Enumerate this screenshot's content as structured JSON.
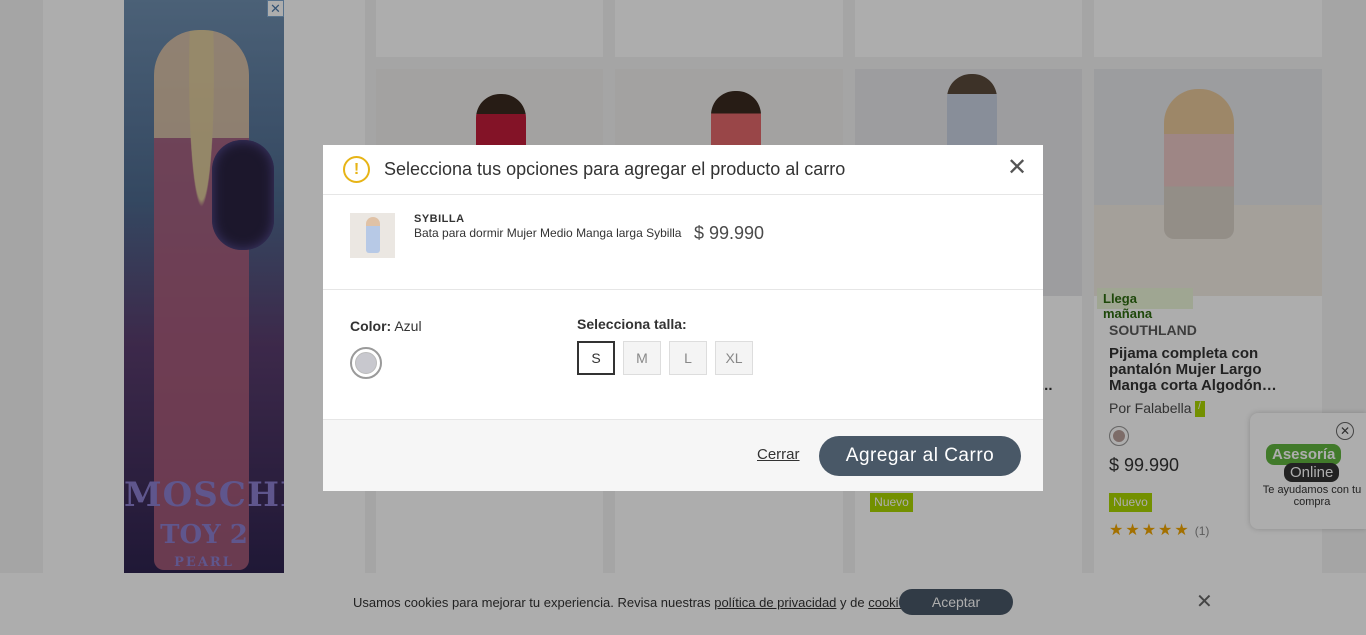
{
  "ad": {
    "brand_line1": "MOSCHINO",
    "brand_line2": "TOY 2",
    "brand_line3": "PEARL",
    "close": "✕"
  },
  "background_product": {
    "badge": "Llega mañana",
    "brand": "SOUTHLAND",
    "title": "Pijama completa con pantalón Mujer Largo Manga corta Algodón…",
    "seller": "Por Falabella",
    "seller_flag": "/",
    "price": "$ 99.990",
    "new_label": "Nuevo",
    "stars": "★★★★★",
    "rating_count": "(1)"
  },
  "background_other": {
    "new_label": "Nuevo",
    "partial_title": "..."
  },
  "chat": {
    "close": "✕",
    "line1": "Asesoría",
    "line2": "Online",
    "text": "Te ayudamos con tu compra"
  },
  "cookie": {
    "text_before": "Usamos cookies para mejorar tu experiencia. Revisa nuestras ",
    "privacy_link": "política de privacidad",
    "text_mid": " y de ",
    "cookies_link": "cookies",
    "text_end": ".",
    "accept": "Aceptar",
    "close": "✕"
  },
  "modal": {
    "warning_icon": "!",
    "title": "Selecciona tus opciones para agregar el producto al carro",
    "close": "✕",
    "product": {
      "brand": "SYBILLA",
      "name": "Bata para dormir Mujer Medio Manga larga Sybilla",
      "price": "$ 99.990"
    },
    "color": {
      "label": "Color:",
      "value": "Azul",
      "swatch_color": "#c8c8ce"
    },
    "size": {
      "label": "Selecciona talla:",
      "options": [
        "S",
        "M",
        "L",
        "XL"
      ],
      "selected": "S"
    },
    "footer": {
      "close_label": "Cerrar",
      "add_label": "Agregar al Carro"
    }
  },
  "colors": {
    "primary_button": "#495867",
    "warning": "#e7b416",
    "badge_green": "#aad500"
  }
}
